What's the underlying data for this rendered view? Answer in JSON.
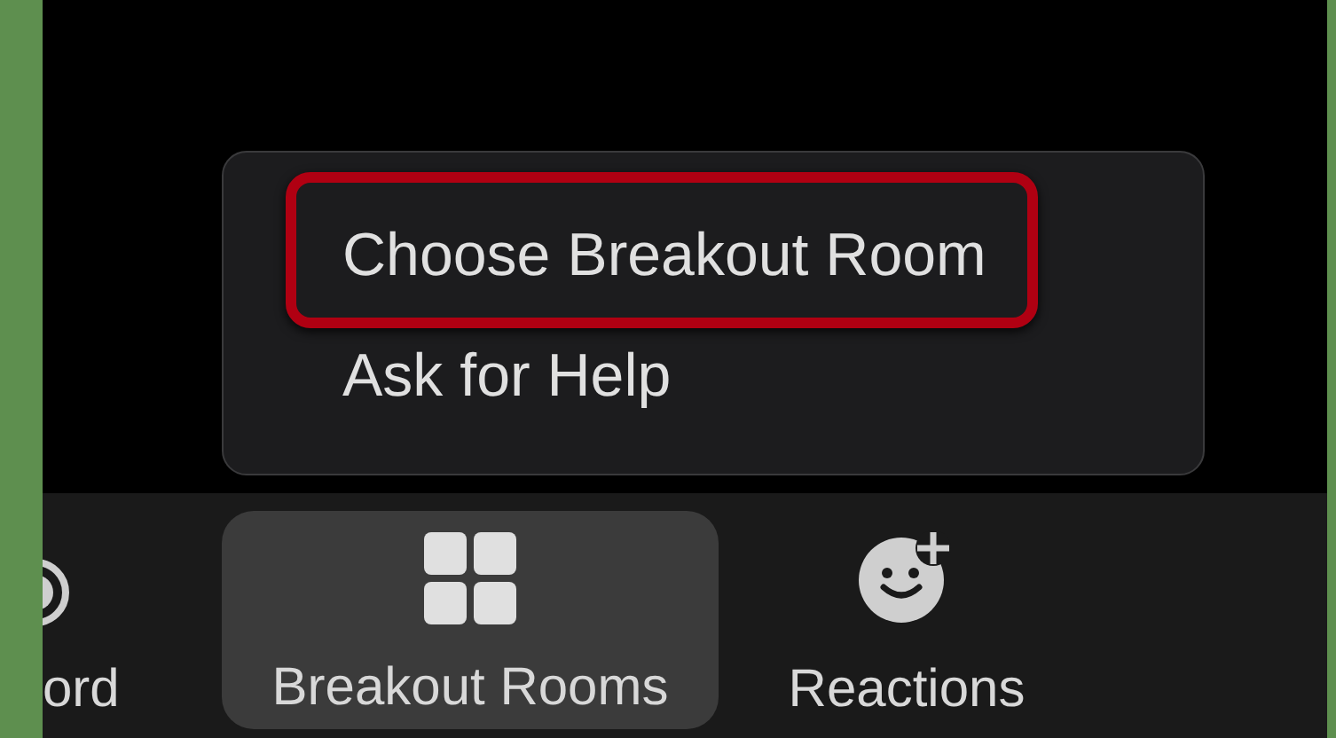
{
  "menu": {
    "items": [
      {
        "label": "Choose Breakout Room",
        "highlighted": true
      },
      {
        "label": "Ask for Help",
        "highlighted": false
      }
    ]
  },
  "toolbar": {
    "items": [
      {
        "kind": "record",
        "label": "ord",
        "selected": false
      },
      {
        "kind": "breakout",
        "label": "Breakout Rooms",
        "selected": true
      },
      {
        "kind": "reactions",
        "label": "Reactions",
        "selected": false
      }
    ]
  }
}
